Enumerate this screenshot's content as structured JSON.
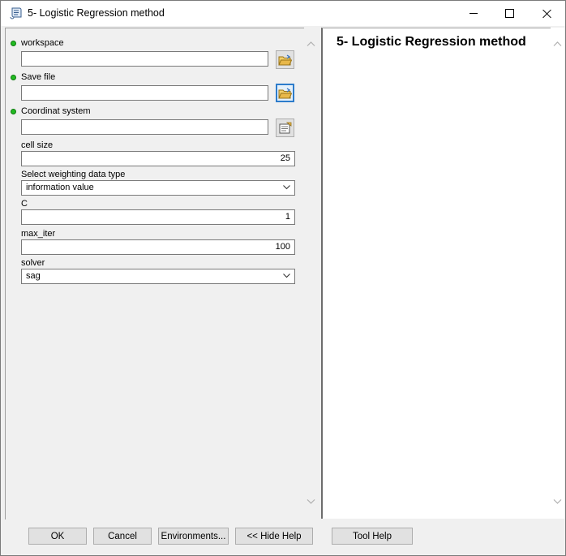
{
  "window": {
    "title": "5- Logistic Regression method",
    "icon": "script-tool-icon",
    "controls": [
      "minimize-icon",
      "maximize-icon",
      "close-icon"
    ]
  },
  "form": {
    "workspace": {
      "label": "workspace",
      "value": "",
      "required": true
    },
    "save_file": {
      "label": "Save file",
      "value": "",
      "required": true
    },
    "coord_system": {
      "label": "Coordinat system",
      "value": "",
      "required": true
    },
    "cell_size": {
      "label": "cell size",
      "value": "25"
    },
    "weighting": {
      "label": "Select weighting data type",
      "value": "information value"
    },
    "c": {
      "label": "C",
      "value": "1"
    },
    "max_iter": {
      "label": "max_iter",
      "value": "100"
    },
    "solver": {
      "label": "solver",
      "value": "sag"
    }
  },
  "help": {
    "title": "5- Logistic Regression method"
  },
  "buttons": {
    "ok": "OK",
    "cancel": "Cancel",
    "environments": "Environments...",
    "hide_help": "<< Hide Help",
    "tool_help": "Tool Help"
  },
  "colors": {
    "required_dot": "#22bb22",
    "focus_border": "#2d7ccb",
    "folder": "#e8b84a"
  }
}
